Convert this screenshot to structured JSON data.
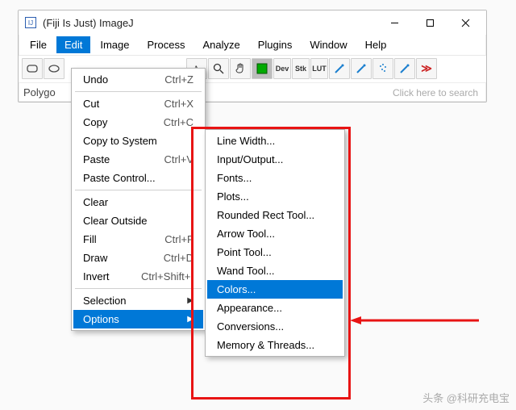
{
  "window": {
    "title": "(Fiji Is Just) ImageJ",
    "icon_letter": "IJ"
  },
  "menubar": {
    "items": [
      {
        "label": "File"
      },
      {
        "label": "Edit"
      },
      {
        "label": "Image"
      },
      {
        "label": "Process"
      },
      {
        "label": "Analyze"
      },
      {
        "label": "Plugins"
      },
      {
        "label": "Window"
      },
      {
        "label": "Help"
      }
    ]
  },
  "toolbar": {
    "dev": "Dev",
    "stk": "Stk",
    "lut": "LUT",
    "more": "≫"
  },
  "status": {
    "label": "Polygo",
    "search_hint": "Click here to search"
  },
  "edit_menu": {
    "undo": {
      "label": "Undo",
      "shortcut": "Ctrl+Z"
    },
    "cut": {
      "label": "Cut",
      "shortcut": "Ctrl+X"
    },
    "copy": {
      "label": "Copy",
      "shortcut": "Ctrl+C"
    },
    "copy_to_system": {
      "label": "Copy to System"
    },
    "paste": {
      "label": "Paste",
      "shortcut": "Ctrl+V"
    },
    "paste_control": {
      "label": "Paste Control..."
    },
    "clear": {
      "label": "Clear"
    },
    "clear_outside": {
      "label": "Clear Outside"
    },
    "fill": {
      "label": "Fill",
      "shortcut": "Ctrl+F"
    },
    "draw": {
      "label": "Draw",
      "shortcut": "Ctrl+D"
    },
    "invert": {
      "label": "Invert",
      "shortcut": "Ctrl+Shift+I"
    },
    "selection": {
      "label": "Selection"
    },
    "options": {
      "label": "Options"
    }
  },
  "options_menu": {
    "line_width": "Line Width...",
    "input_output": "Input/Output...",
    "fonts": "Fonts...",
    "plots": "Plots...",
    "rounded_rect": "Rounded Rect Tool...",
    "arrow_tool": "Arrow Tool...",
    "point_tool": "Point Tool...",
    "wand_tool": "Wand Tool...",
    "colors": "Colors...",
    "appearance": "Appearance...",
    "conversions": "Conversions...",
    "memory": "Memory & Threads..."
  },
  "watermark": "头条 @科研充电宝"
}
